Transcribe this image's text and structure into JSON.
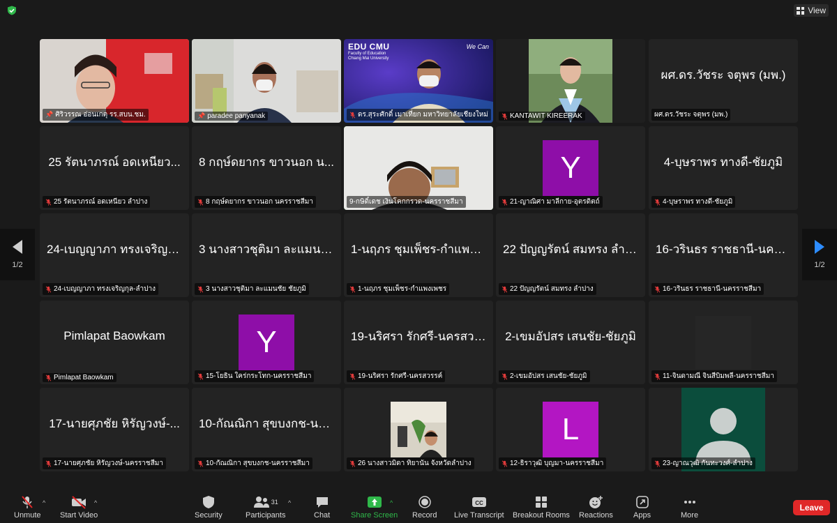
{
  "topbar": {
    "view_label": "View"
  },
  "pager": {
    "left": "1/2",
    "right": "1/2"
  },
  "row1": {
    "t1": "ศิริวรรณ อ่อนเกตุ รร.สบน.ชม.",
    "t2": "paradee panyanak",
    "t3": "ดร.สุระศักดิ์ เมาเที่ยก มหาวิทยาลัยเชียงใหม่",
    "t3_banner": "EDU CMU",
    "t3_banner_sub1": "Faculty of Education",
    "t3_banner_sub2": "Chiang Mai University",
    "t3_wecan": "We Can",
    "t4": "KANTAWIT KIREERAK",
    "t5_big": "ผศ.ดร.วัชระ จตุพร (มพ.)",
    "t5": "ผศ.ดร.วัชระ จตุพร (มพ.)"
  },
  "row2": {
    "t1_big": "25 รัตนาภรณ์ อดเหนียว...",
    "t1": "25 รัตนาภรณ์ อดเหนียว ลำปาง",
    "t2_big": "8 กฤษ์ดยากร ขาวนอก น...",
    "t2": "8 กฤษ์ดยากร ขาวนอก นครราชสีมา",
    "t3": "9-กษิดิ์เดช เงินโคกกรวด-นครราชสีมา",
    "t4_initial": "Y",
    "t4": "21-ญาณิศา มาลีกาย-อุตรดิตถ์",
    "t5_big": "4-บุษราพร ทางดี-ชัยภูมิ",
    "t5": "4-บุษราพร ทางดี-ชัยภูมิ"
  },
  "row3": {
    "t1_big": "24-เบญญาภา ทรงเจริญกุ...",
    "t1": "24-เบญญาภา ทรงเจริญกุล-ลำปาง",
    "t2_big": "3 นางสาวชุติมา ละแมนชั...",
    "t2": "3 นางสาวชุติมา ละแมนชัย ชัยภูมิ",
    "t3_big": "1-นฤภร ชุมเพ็ชร-กำแพงเ...",
    "t3": "1-นฤภร ชุมเพ็ชร-กำแพงเพชร",
    "t4_big": "22 ปัญญรัตน์ สมทรง ลำปาง",
    "t4": "22 ปัญญรัตน์ สมทรง ลำปาง",
    "t5_big": "16-วรินธร ราชธานี-นครร...",
    "t5": "16-วรินธร ราชธานี-นครราชสีมา"
  },
  "row4": {
    "t1_big": "Pimlapat Baowkam",
    "t1": "Pimlapat Baowkam",
    "t2_initial": "Y",
    "t2": "15-โยธิน ใคร่กระโทก-นครราชสีมา",
    "t3_big": "19-นริศรา รักศรี-นครสวร...",
    "t3": "19-นริศรา รักศรี-นครสวรรค์",
    "t4_big": "2-เขมอัปสร เสนชัย-ชัยภูมิ",
    "t4": "2-เขมอัปสร เสนชัย-ชัยภูมิ",
    "t5": "11-จินดามณี จินสีบิมพลี-นครราชสีมา"
  },
  "row5": {
    "t1_big": "17-นายศุภชัย หิรัญวงษ์-...",
    "t1": "17-นายศุภชัย หิรัญวงษ์-นครราชสีมา",
    "t2_big": "10-กัณณิกา สุขบงกช-นค...",
    "t2": "10-กัณณิกา สุขบงกช-นครราชสีมา",
    "t3": "26 นางสาวมิดา ทิยานัน จังหวัดลำปาง",
    "t4_initial": "L",
    "t4": "12-ธิราวุฒิ บุญมา-นครราชสีมา",
    "t5": "23-ญาณวุฒิ กันทะวงศ์-ลำปาง"
  },
  "toolbar": {
    "unmute": "Unmute",
    "start_video": "Start Video",
    "security": "Security",
    "participants": "Participants",
    "participants_count": "31",
    "chat": "Chat",
    "share_screen": "Share Screen",
    "record": "Record",
    "live_transcript": "Live Transcript",
    "breakout_rooms": "Breakout Rooms",
    "reactions": "Reactions",
    "apps": "Apps",
    "more": "More",
    "leave": "Leave"
  },
  "colors": {
    "avatar_purple": "#8e0ea8",
    "avatar_magenta": "#b316c3",
    "avatar_teal": "#0b4d3c",
    "share_green": "#2fb84a",
    "leave_red": "#e02828",
    "active_speaker": "#2fb84a"
  }
}
